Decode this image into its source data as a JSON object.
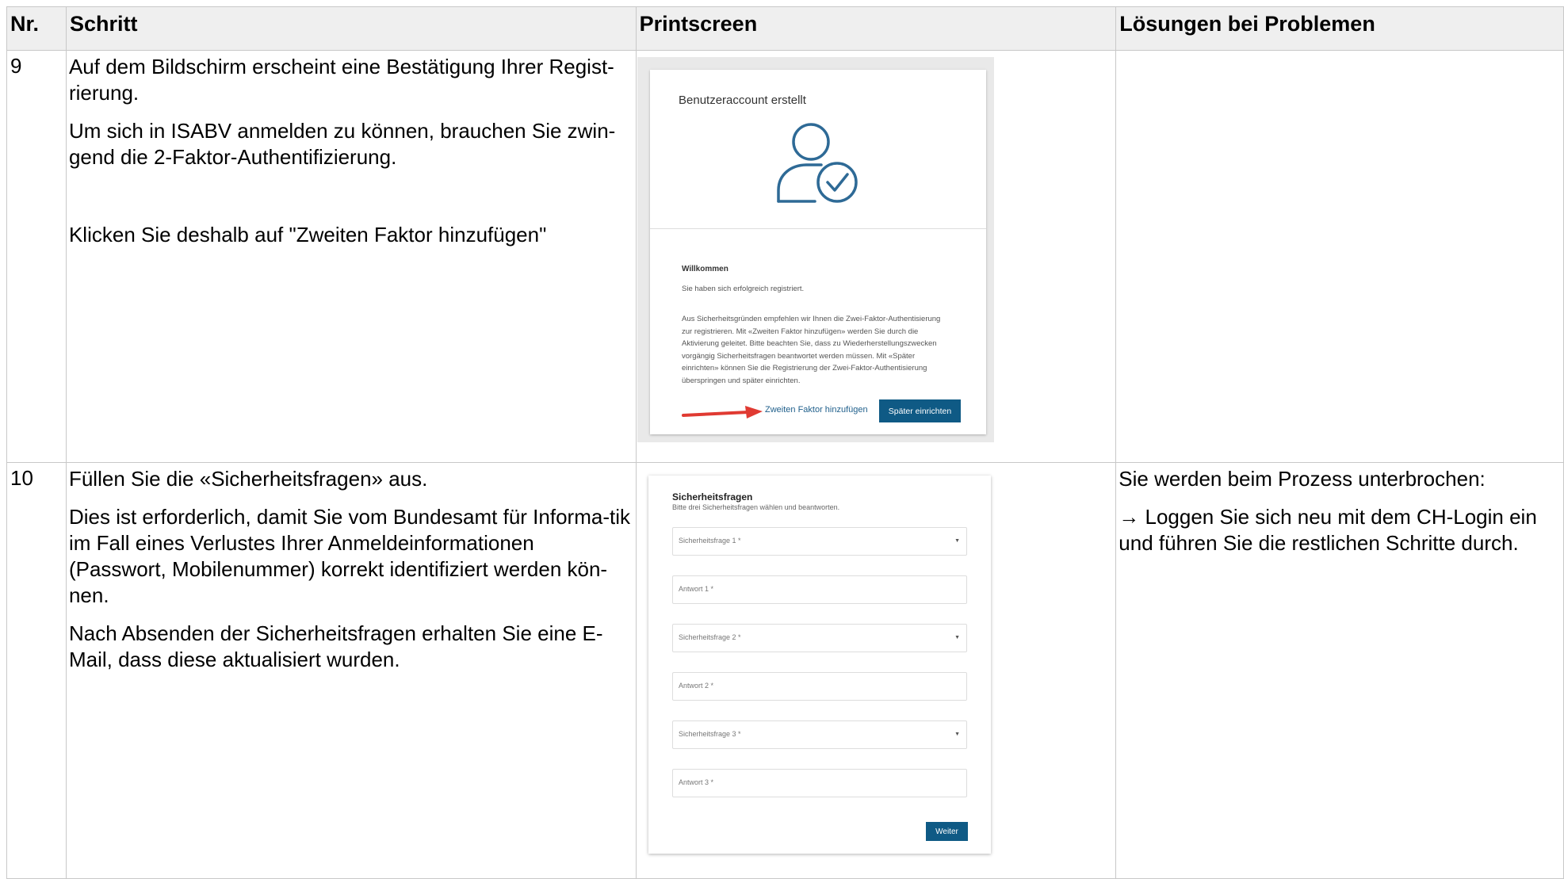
{
  "table": {
    "headers": {
      "nr": "Nr.",
      "schritt": "Schritt",
      "printscreen": "Printscreen",
      "loesungen": "Lösungen bei Problemen"
    },
    "rows": [
      {
        "nr": "9",
        "paragraphs": [
          "Auf dem Bildschirm erscheint eine Bestätigung Ihrer Regist-rierung.",
          "Um sich in ISABV anmelden zu können, brauchen Sie zwin-gend die 2-Faktor-Authentifizierung.",
          "Klicken Sie deshalb auf \"Zweiten Faktor hinzufügen\""
        ],
        "solutions": []
      },
      {
        "nr": "10",
        "paragraphs": [
          "Füllen Sie die «Sicherheitsfragen» aus.",
          "Dies ist erforderlich, damit Sie vom Bundesamt für Informa-tik im Fall eines Verlustes Ihrer Anmeldeinformationen (Passwort, Mobilenummer) korrekt identifiziert werden kön-nen.",
          "Nach Absenden der Sicherheitsfragen erhalten Sie eine E-Mail, dass diese aktualisiert wurden."
        ],
        "solutions": [
          "Sie werden beim Prozess unterbrochen:",
          "→ Loggen Sie sich neu mit dem CH-Login ein und führen Sie die restlichen Schritte durch."
        ]
      }
    ]
  },
  "screenshot1": {
    "title": "Benutzeraccount erstellt",
    "welcome": "Willkommen",
    "registered": "Sie haben sich erfolgreich registriert.",
    "paragraph": "Aus Sicherheitsgründen empfehlen wir Ihnen die Zwei-Faktor-Authentisierung zur registrieren. Mit «Zweiten Faktor hinzufügen» werden Sie durch die Aktivierung geleitet. Bitte beachten Sie, dass zu Wiederherstellungszwecken vorgängig Sicherheitsfragen beantwortet werden müssen. Mit «Später einrichten» können Sie die Registrierung der Zwei-Faktor-Authentisierung überspringen und später einrichten.",
    "link_label": "Zweiten Faktor hinzufügen",
    "button_label": "Später einrichten",
    "colors": {
      "primary": "#0f5a85",
      "icon": "#2e6a96",
      "arrow": "#e03a32"
    },
    "icon_name": "user-check-icon"
  },
  "screenshot2": {
    "title": "Sicherheitsfragen",
    "subtitle": "Bitte drei Sicherheitsfragen wählen und beantworten.",
    "fields": [
      {
        "label": "Sicherheitsfrage 1 *",
        "type": "select"
      },
      {
        "label": "Antwort 1 *",
        "type": "text"
      },
      {
        "label": "Sicherheitsfrage 2 *",
        "type": "select"
      },
      {
        "label": "Antwort 2 *",
        "type": "text"
      },
      {
        "label": "Sicherheitsfrage 3 *",
        "type": "select"
      },
      {
        "label": "Antwort 3 *",
        "type": "text"
      }
    ],
    "caret_glyph": "▼",
    "submit_label": "Weiter"
  }
}
